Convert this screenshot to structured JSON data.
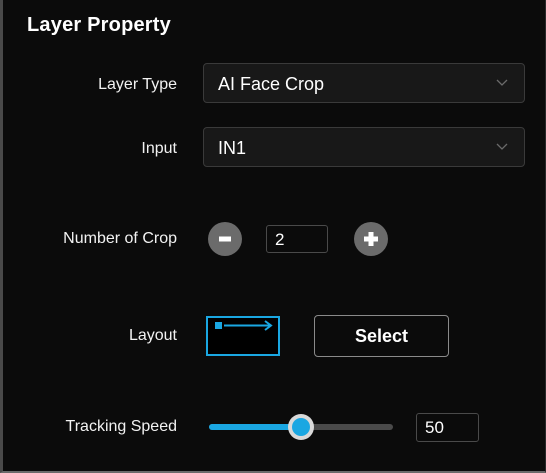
{
  "panel": {
    "title": "Layer Property"
  },
  "layer_type": {
    "label": "Layer Type",
    "value": "AI Face Crop"
  },
  "input": {
    "label": "Input",
    "value": "IN1"
  },
  "number_of_crop": {
    "label": "Number of Crop",
    "value": "2"
  },
  "layout": {
    "label": "Layout",
    "select_label": "Select"
  },
  "tracking_speed": {
    "label": "Tracking Speed",
    "value": "50",
    "fraction": 0.5
  },
  "colors": {
    "accent": "#1aa7e2",
    "background": "#0b0b0b",
    "control_gray": "#6b6b6b"
  },
  "icons": {
    "dropdown": "chevron-down-icon",
    "decrement": "minus-icon",
    "increment": "plus-icon",
    "layout": "layout-arrow-icon"
  }
}
